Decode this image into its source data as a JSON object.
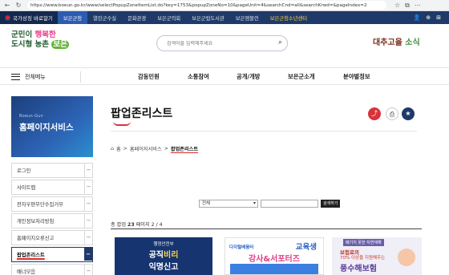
{
  "browser": {
    "url": "https://www.boeun.go.kr/www/selectPopupZoneItemList.do?key=1753&popupZoneNo=10&pageUnit=4&searchCnd=all&searchKrwd=&pageIndex=2"
  },
  "portal": {
    "gov_label": "국가상징 바로알기",
    "tabs": [
      "보은군청",
      "열린군수실",
      "문화관광",
      "보은군의회",
      "보은군립도서관",
      "보은앰블런",
      "보은군청소년센터"
    ]
  },
  "header": {
    "logo_line1": "군민이 ",
    "logo_line1_accent": "행복한",
    "logo_line2": "도시형 농촌 ",
    "logo_line2_accent": "보은",
    "search_placeholder": "검색어를 입력해주세요",
    "slogan_a": "대추고을 ",
    "slogan_b": "소식"
  },
  "mainnav": {
    "all_menu": "전체메뉴",
    "items": [
      "감동민원",
      "소통참여",
      "공개/개방",
      "보은군소개",
      "분야별정보"
    ]
  },
  "sidebar": {
    "eng_title": "Boeun-Gun",
    "title": "홈페이지서비스",
    "items": [
      "로그인",
      "사이트맵",
      "전자우편무단수집거부",
      "개인정보처리방침",
      "홈페이지오류신고",
      "팝업존리스트",
      "배너모음"
    ],
    "active_index": 5
  },
  "content": {
    "page_title": "팝업존리스트",
    "breadcrumb_home": "홈",
    "breadcrumb_parent": "홈페이지서비스",
    "breadcrumb_current": "팝업존리스트",
    "filter_select": "전체",
    "search_button": "검색하기",
    "total_label": "총 팝업",
    "total_count": "23",
    "page_label": "페이지",
    "page_info": "2 / 4"
  },
  "popups": [
    {
      "line1": "행정안전부",
      "line2a": "공직",
      "line2b": "비리",
      "line3": "익명신고"
    },
    {
      "brand": "다지털배움터",
      "line1": "교육생",
      "line2": "강사&서포터즈"
    },
    {
      "tag": "폐기지 못한 자연재해",
      "line1": "보험료의",
      "line2": "70% 이상을 지원해주는",
      "line3": "풍수해보험"
    }
  ],
  "icons": {
    "share": "share-icon",
    "print": "print-icon",
    "favorite": "star-icon"
  },
  "colors": {
    "portal_bar": "#1f3a68",
    "accent_red": "#d8333a",
    "sidebar_gradient_start": "#1c3f7c",
    "sidebar_gradient_end": "#2b8fd0"
  }
}
